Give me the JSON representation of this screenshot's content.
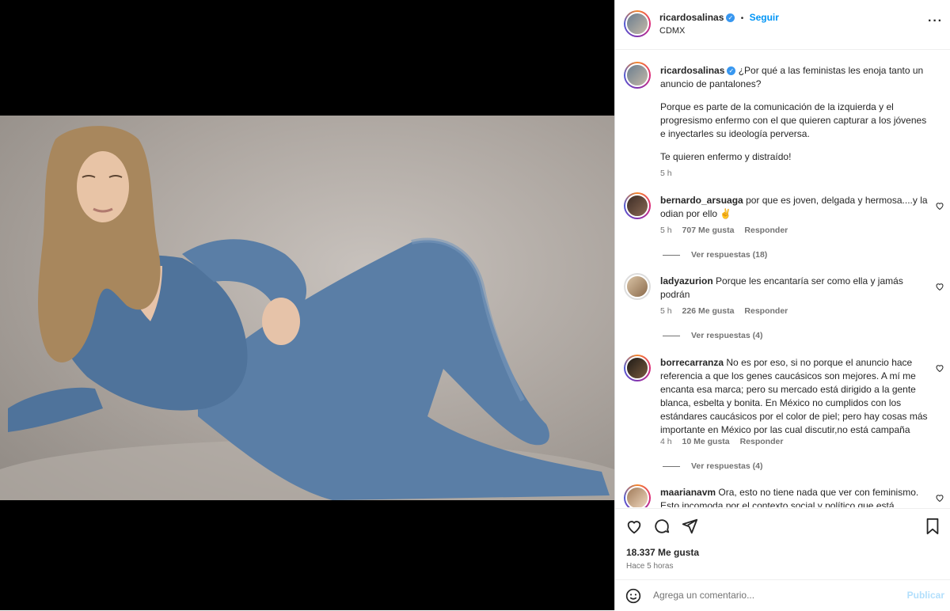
{
  "post": {
    "username": "ricardosalinas",
    "follow_label": "Seguir",
    "location": "CDMX",
    "caption_p1": "¿Por qué a las feministas les enoja tanto un anuncio de pantalones?",
    "caption_p2": "Porque es parte de la comunicación de la izquierda y el progresismo enfermo con el que quieren capturar a los jóvenes e inyectarles su ideología perversa.",
    "caption_p3": "Te quieren enfermo y distraído!",
    "caption_time": "5 h"
  },
  "comments": [
    {
      "username": "bernardo_arsuaga",
      "text": "por que es joven, delgada y hermosa....y la odian por ello ✌",
      "time": "5 h",
      "likes": "707 Me gusta",
      "reply": "Responder",
      "replies": "Ver respuestas (18)"
    },
    {
      "username": "ladyazurion",
      "text": "Porque les encantaría ser como ella y jamás podrán",
      "time": "5 h",
      "likes": "226 Me gusta",
      "reply": "Responder",
      "replies": "Ver respuestas (4)"
    },
    {
      "username": "borrecarranza",
      "text": "No es por eso, si no porque el anuncio hace referencia a que los genes caucásicos son mejores. A mí me encanta esa marca; pero su mercado está dirigido a la gente blanca, esbelta y bonita. En México no cumplidos con los estándares caucásicos por el color de piel; pero hay cosas más importante en México por las cual discutir,no está campaña",
      "time": "4 h",
      "likes": "10 Me gusta",
      "reply": "Responder",
      "replies": "Ver respuestas (4)"
    },
    {
      "username": "maarianavm",
      "text": "Ora, esto no tiene nada que ver con feminismo. Esto incomoda por el contexto social y político que está"
    }
  ],
  "footer": {
    "likes": "18.337 Me gusta",
    "time": "Hace 5 horas",
    "comment_placeholder": "Agrega un comentario...",
    "publish_label": "Publicar"
  },
  "icons": {
    "like": "heart-icon",
    "comment": "comment-icon",
    "share": "paper-plane-icon",
    "save": "bookmark-icon",
    "emoji": "emoji-icon",
    "more": "more-dots-icon"
  },
  "colors": {
    "link": "#0095f6",
    "verified": "#3897f0",
    "muted": "#737373"
  }
}
